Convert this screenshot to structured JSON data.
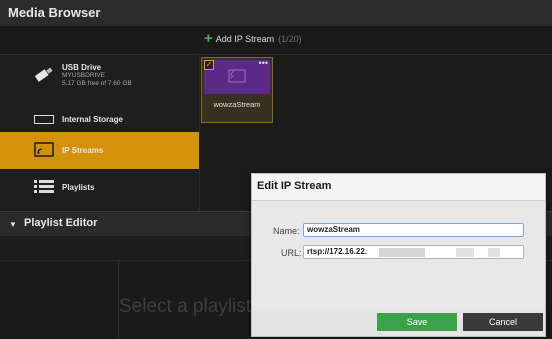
{
  "window": {
    "title": "Media Browser"
  },
  "toolbar": {
    "add_stream_label": "Add IP Stream",
    "add_stream_count": "(1/20)"
  },
  "sidebar": {
    "usb": {
      "name": "USB Drive",
      "volume": "MYUSBDRIVE",
      "free": "5.17 GB free of 7.60 GB"
    },
    "items": [
      {
        "label": "Internal Storage",
        "icon": "storage-icon"
      },
      {
        "label": "IP Streams",
        "icon": "ip-stream-icon",
        "active": true
      },
      {
        "label": "Playlists",
        "icon": "playlist-icon"
      }
    ]
  },
  "grid": {
    "items": [
      {
        "name": "wowzaStream",
        "selected": true
      }
    ]
  },
  "playlist_editor": {
    "title": "Playlist Editor",
    "placeholder": "Select a playlist"
  },
  "dialog": {
    "title": "Edit IP Stream",
    "name_label": "Name:",
    "name_value": "wowzaStream",
    "url_label": "URL:",
    "url_value": "rtsp://172.16.22.",
    "save_label": "Save",
    "cancel_label": "Cancel"
  },
  "colors": {
    "accent": "#d4920a",
    "save": "#3ca24a",
    "cancel": "#3a3a3a",
    "thumb": "#5b2a86"
  }
}
